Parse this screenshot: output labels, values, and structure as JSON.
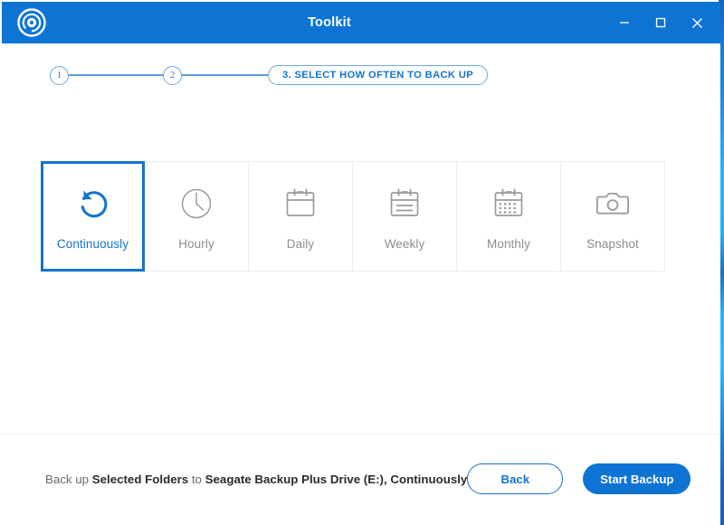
{
  "window": {
    "title": "Toolkit",
    "logo_icon": "seagate-disc-icon",
    "controls": {
      "minimize": "minimize-icon",
      "maximize": "maximize-icon",
      "close": "close-icon"
    },
    "accent_color": "#0e74d4",
    "title_color": "#ffffff"
  },
  "stepper": {
    "steps": [
      {
        "number": "1",
        "label": "",
        "state": "complete"
      },
      {
        "number": "2",
        "label": "",
        "state": "complete"
      },
      {
        "number": "3",
        "label": "3. SELECT HOW OFTEN TO BACK UP",
        "state": "current"
      }
    ],
    "line_color": "#5b9bd9",
    "text_color": "#1473cc"
  },
  "options": {
    "selected_index": 0,
    "items": [
      {
        "label": "Continuously",
        "icon": "refresh-loop-icon",
        "selected": true
      },
      {
        "label": "Hourly",
        "icon": "clock-icon",
        "selected": false
      },
      {
        "label": "Daily",
        "icon": "calendar-blank-icon",
        "selected": false
      },
      {
        "label": "Weekly",
        "icon": "calendar-lines-icon",
        "selected": false
      },
      {
        "label": "Monthly",
        "icon": "calendar-dots-icon",
        "selected": false
      },
      {
        "label": "Snapshot",
        "icon": "camera-icon",
        "selected": false
      }
    ],
    "selected_color": "#1473cc",
    "unselected_color": "#8d8d8d"
  },
  "footer": {
    "summary": {
      "prefix": "Back up ",
      "source": "Selected Folders",
      "middle": " to ",
      "destination": "Seagate Backup Plus Drive (E:)",
      "separator": ", ",
      "frequency": "Continuously"
    },
    "back_label": "Back",
    "start_label": "Start Backup"
  }
}
